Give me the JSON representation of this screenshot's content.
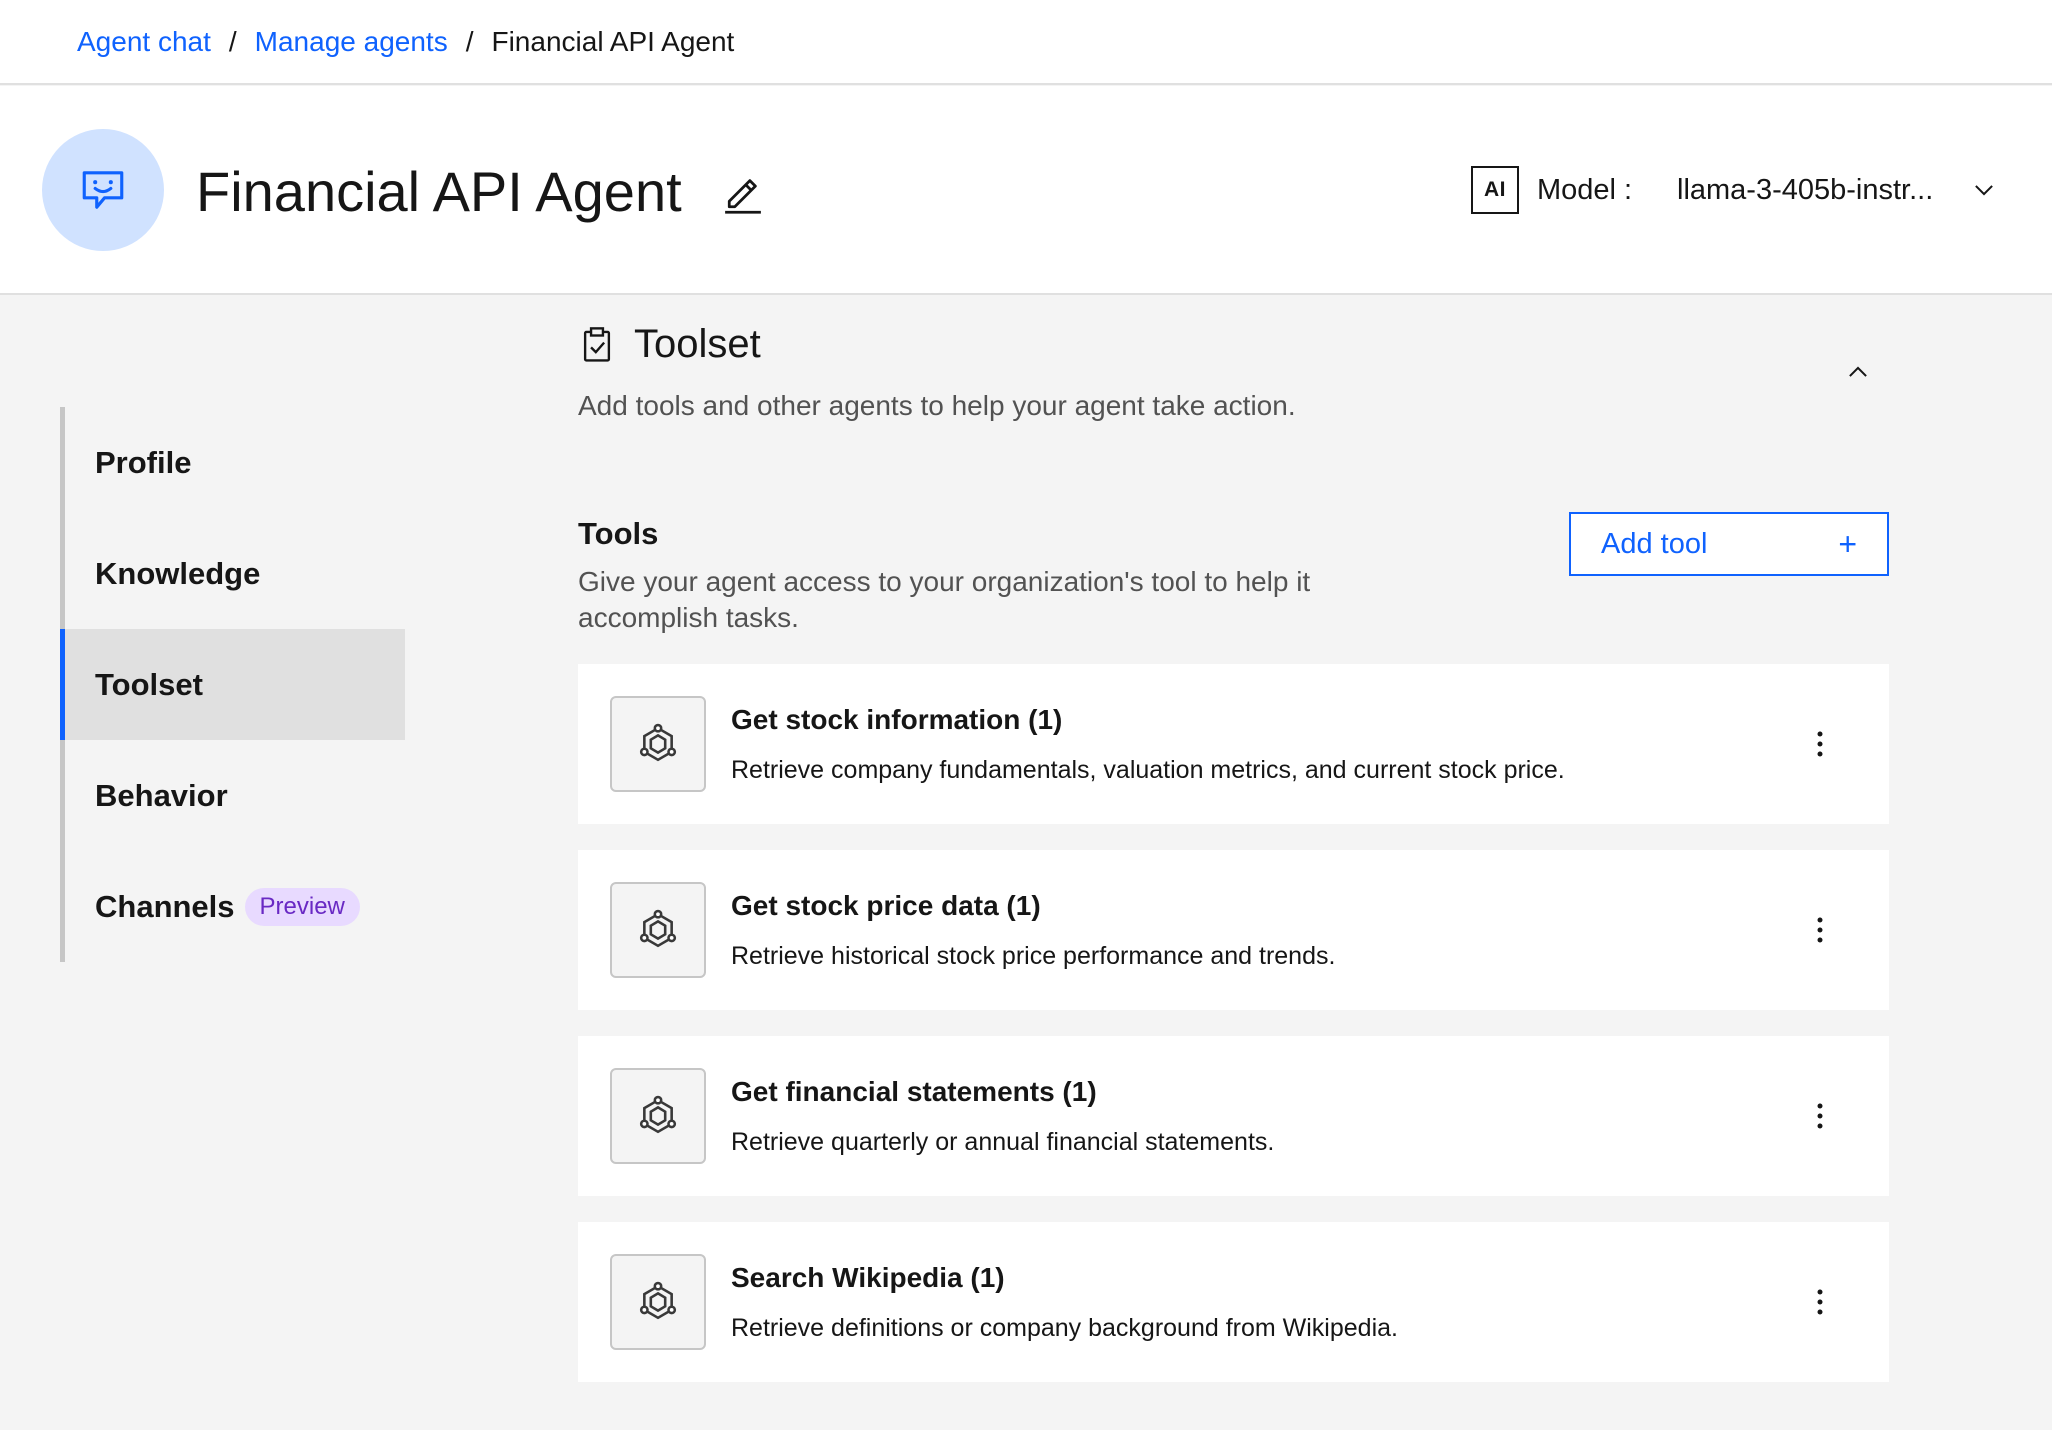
{
  "breadcrumb": {
    "items": [
      {
        "label": "Agent chat"
      },
      {
        "label": "Manage agents"
      }
    ],
    "current": "Financial API Agent",
    "separator": "/"
  },
  "header": {
    "title": "Financial API Agent",
    "model_badge": "AI",
    "model_label": "Model :",
    "model_value": "llama-3-405b-instr..."
  },
  "sidenav": {
    "items": [
      {
        "label": "Profile"
      },
      {
        "label": "Knowledge"
      },
      {
        "label": "Toolset",
        "active": true
      },
      {
        "label": "Behavior"
      },
      {
        "label": "Channels",
        "tag": "Preview"
      }
    ]
  },
  "section": {
    "title": "Toolset",
    "description": "Add tools and other agents to help your agent take action."
  },
  "tools": {
    "title": "Tools",
    "description": "Give your agent access to your organization's tool to help it accomplish tasks.",
    "add_button": "Add tool",
    "add_icon": "+",
    "items": [
      {
        "name": "Get stock information (1)",
        "description": "Retrieve company fundamentals, valuation metrics, and current stock price."
      },
      {
        "name": "Get stock price data (1)",
        "description": "Retrieve historical stock price performance and trends."
      },
      {
        "name": "Get financial statements (1)",
        "description": "Retrieve quarterly or annual financial statements."
      },
      {
        "name": "Search Wikipedia (1)",
        "description": "Retrieve definitions or company background from Wikipedia."
      }
    ]
  },
  "colors": {
    "accent": "#0f62fe",
    "avatar_bg": "#d0e2ff",
    "preview_bg": "#e8daff",
    "preview_fg": "#6929c4"
  },
  "icons": [
    "chat-bot-icon",
    "edit-pencil-icon",
    "chevron-down-icon",
    "clipboard-check-icon",
    "chevron-up-icon",
    "plus-icon",
    "tool-hexagon-icon",
    "overflow-menu-icon"
  ]
}
